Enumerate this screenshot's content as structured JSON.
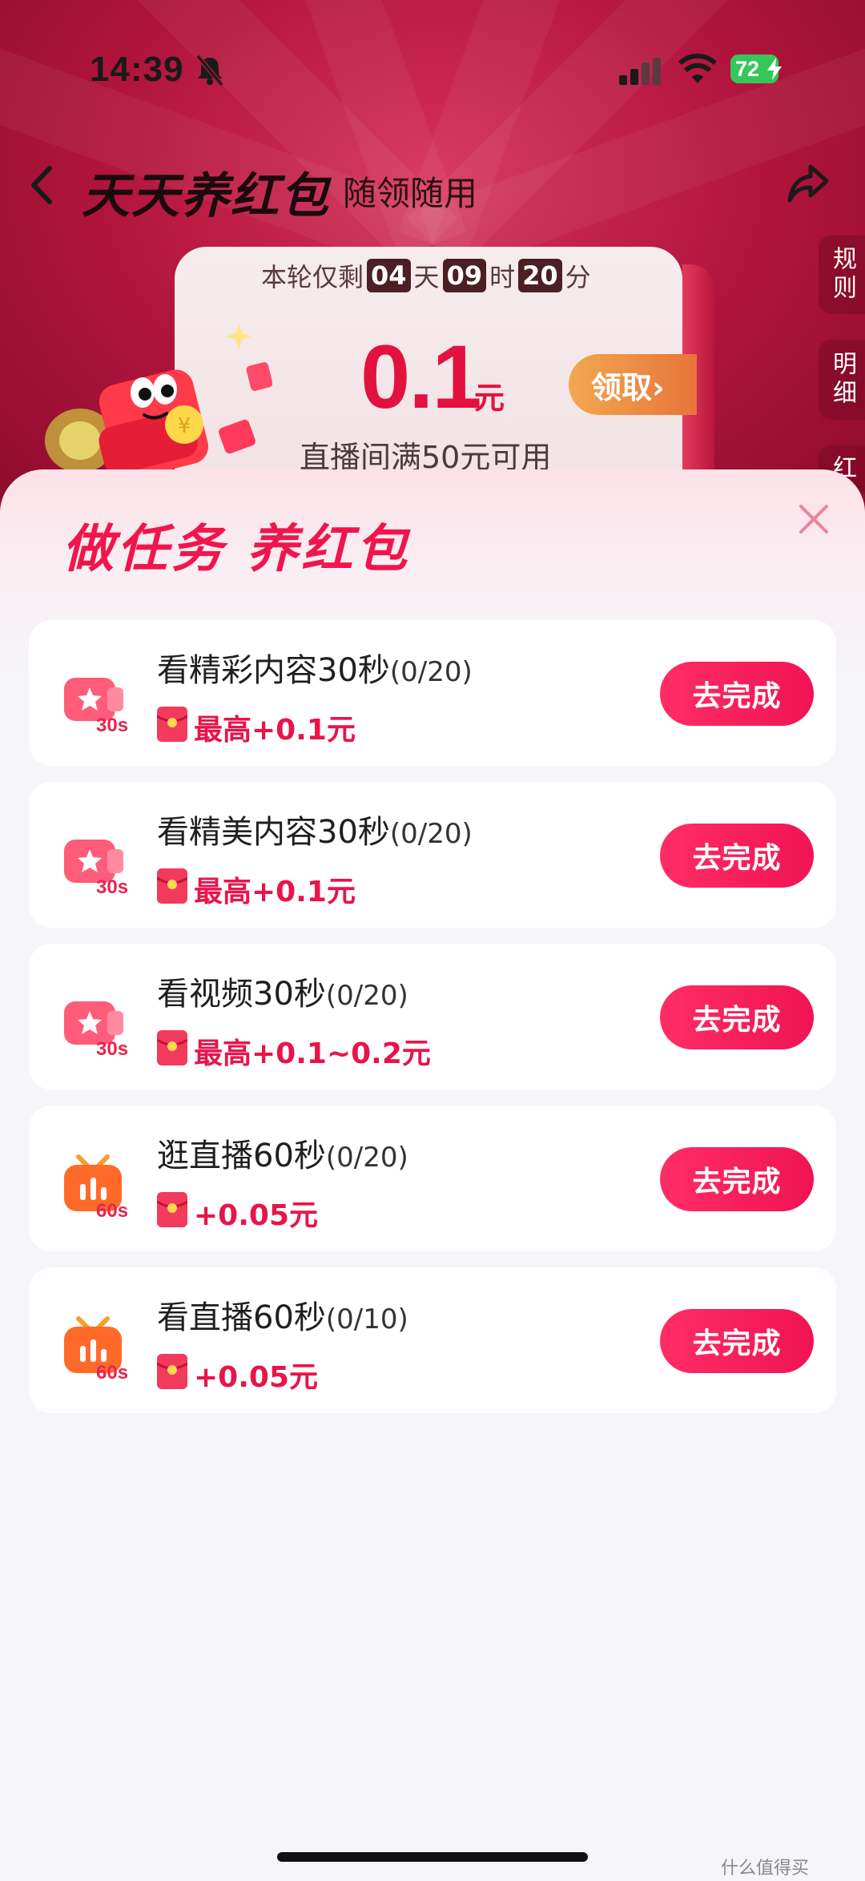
{
  "status_bar": {
    "time": "14:39",
    "battery": "72"
  },
  "header": {
    "title": "天天养红包",
    "subtitle": "随领随用"
  },
  "side_tabs": [
    "规则",
    "明细",
    "红"
  ],
  "coupon": {
    "countdown_prefix": "本轮仅剩",
    "days": "04",
    "days_unit": "天",
    "hours": "09",
    "hours_unit": "时",
    "minutes": "20",
    "minutes_unit": "分",
    "amount": "0.1",
    "unit": "元",
    "claim_label": "领取›",
    "description": "直播间满50元可用"
  },
  "sheet": {
    "title": "做任务 养红包",
    "tasks": [
      {
        "icon": "star-video-icon",
        "badge": "30s",
        "name": "看精彩内容30秒",
        "progress": "(0/20)",
        "reward": "最高+0.1元",
        "button": "去完成"
      },
      {
        "icon": "star-video-icon",
        "badge": "30s",
        "name": "看精美内容30秒",
        "progress": "(0/20)",
        "reward": "最高+0.1元",
        "button": "去完成"
      },
      {
        "icon": "star-video-icon",
        "badge": "30s",
        "name": "看视频30秒",
        "progress": "(0/20)",
        "reward": "最高+0.1~0.2元",
        "button": "去完成"
      },
      {
        "icon": "live-tv-icon",
        "badge": "60s",
        "name": "逛直播60秒",
        "progress": "(0/20)",
        "reward": "+0.05元",
        "button": "去完成"
      },
      {
        "icon": "live-tv-icon",
        "badge": "60s",
        "name": "看直播60秒",
        "progress": "(0/10)",
        "reward": "+0.05元",
        "button": "去完成"
      }
    ]
  },
  "watermark": "什么值得买",
  "colors": {
    "accent": "#f01452",
    "header_bg": "#b0143c",
    "reward_text": "#e8144a"
  }
}
